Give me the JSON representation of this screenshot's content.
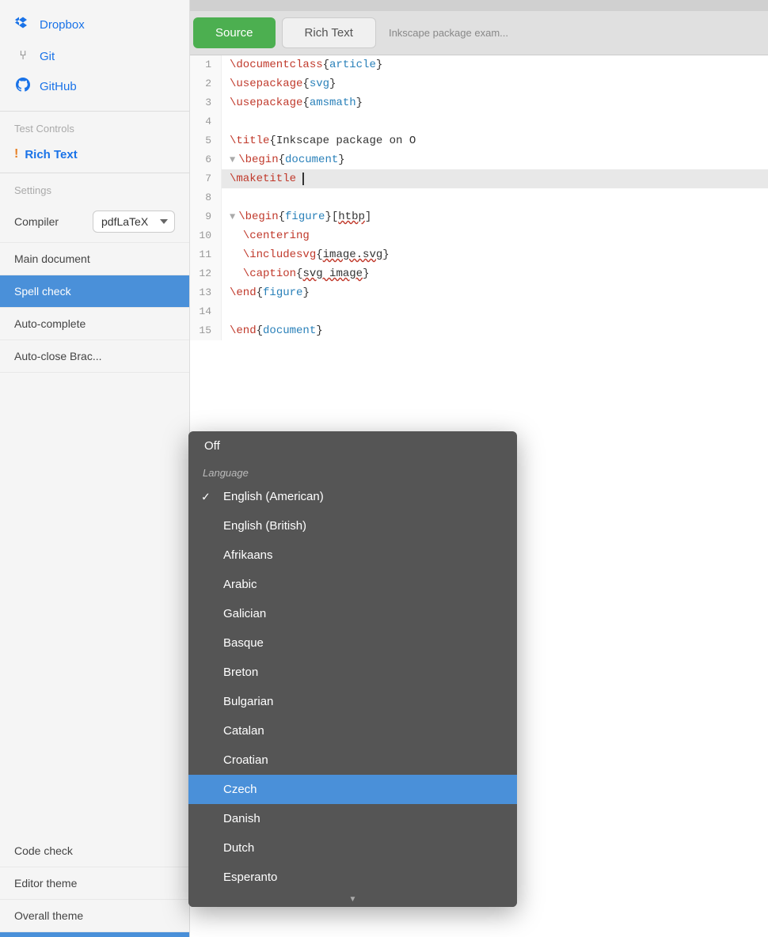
{
  "sidebar": {
    "nav_items": [
      {
        "id": "dropbox",
        "icon": "◈",
        "label": "Dropbox"
      },
      {
        "id": "git",
        "icon": "⑂",
        "label": "Git"
      },
      {
        "id": "github",
        "icon": "⊙",
        "label": "GitHub"
      }
    ],
    "test_controls_label": "Test Controls",
    "rich_text_label": "Rich Text",
    "settings_label": "Settings",
    "settings_rows": [
      {
        "id": "compiler",
        "label": "Compiler",
        "value": "pdfLaTeX",
        "type": "select"
      },
      {
        "id": "main-document",
        "label": "Main document",
        "type": "text"
      },
      {
        "id": "spell-check",
        "label": "Spell check",
        "active": true
      },
      {
        "id": "auto-complete",
        "label": "Auto-complete"
      },
      {
        "id": "auto-close-brac",
        "label": "Auto-close Brac..."
      },
      {
        "id": "code-check",
        "label": "Code check"
      },
      {
        "id": "editor-theme",
        "label": "Editor theme"
      },
      {
        "id": "overall-theme",
        "label": "Overall theme"
      }
    ]
  },
  "dropdown": {
    "off_label": "Off",
    "section_label": "Language",
    "items": [
      {
        "id": "english-american",
        "label": "English (American)",
        "selected": true
      },
      {
        "id": "english-british",
        "label": "English (British)"
      },
      {
        "id": "afrikaans",
        "label": "Afrikaans"
      },
      {
        "id": "arabic",
        "label": "Arabic"
      },
      {
        "id": "galician",
        "label": "Galician"
      },
      {
        "id": "basque",
        "label": "Basque"
      },
      {
        "id": "breton",
        "label": "Breton"
      },
      {
        "id": "bulgarian",
        "label": "Bulgarian"
      },
      {
        "id": "catalan",
        "label": "Catalan"
      },
      {
        "id": "croatian",
        "label": "Croatian"
      },
      {
        "id": "czech",
        "label": "Czech",
        "highlighted": true
      },
      {
        "id": "danish",
        "label": "Danish"
      },
      {
        "id": "dutch",
        "label": "Dutch"
      },
      {
        "id": "esperanto",
        "label": "Esperanto"
      }
    ],
    "scroll_arrow": "▼"
  },
  "editor": {
    "tabs": [
      {
        "id": "source",
        "label": "Source",
        "active": true
      },
      {
        "id": "rich-text",
        "label": "Rich Text",
        "active": false
      }
    ],
    "title": "Inkscape package exam...",
    "lines": [
      {
        "num": "1",
        "content": "\\documentclass{article}",
        "fold": false,
        "highlight": false
      },
      {
        "num": "2",
        "content": "\\usepackage{svg}",
        "fold": false,
        "highlight": false
      },
      {
        "num": "3",
        "content": "\\usepackage{amsmath}",
        "fold": false,
        "highlight": false
      },
      {
        "num": "4",
        "content": "",
        "fold": false,
        "highlight": false
      },
      {
        "num": "5",
        "content": "\\title{Inkscape package on O",
        "fold": false,
        "highlight": false
      },
      {
        "num": "6",
        "content": "\\begin{document}",
        "fold": true,
        "highlight": false
      },
      {
        "num": "7",
        "content": "\\maketitle",
        "fold": false,
        "highlight": true
      },
      {
        "num": "8",
        "content": "",
        "fold": false,
        "highlight": false
      },
      {
        "num": "9",
        "content": "\\begin{figure}[htbp]",
        "fold": true,
        "highlight": false
      },
      {
        "num": "10",
        "content": "  \\centering",
        "fold": false,
        "highlight": false
      },
      {
        "num": "11",
        "content": "  \\includesvg{image.svg}",
        "fold": false,
        "highlight": false
      },
      {
        "num": "12",
        "content": "  \\caption{svg image}",
        "fold": false,
        "highlight": false
      },
      {
        "num": "13",
        "content": "\\end{figure}",
        "fold": false,
        "highlight": false
      },
      {
        "num": "14",
        "content": "",
        "fold": false,
        "highlight": false
      },
      {
        "num": "15",
        "content": "\\end{document}",
        "fold": false,
        "highlight": false
      }
    ]
  }
}
